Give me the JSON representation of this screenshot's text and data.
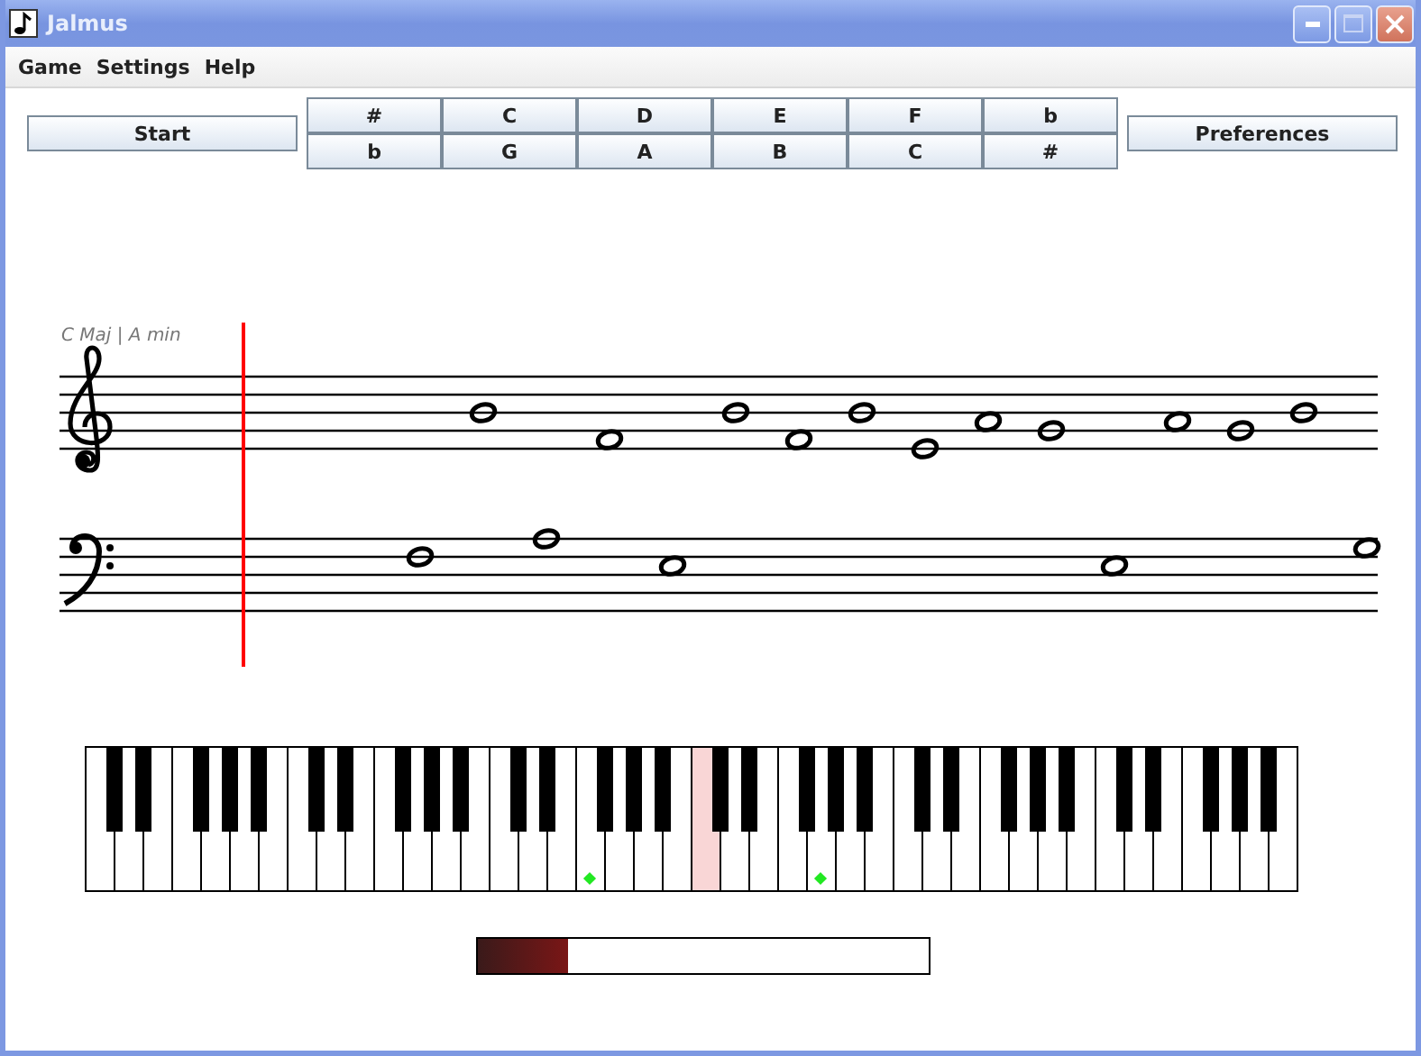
{
  "window": {
    "title": "Jalmus"
  },
  "menu": [
    "Game",
    "Settings",
    "Help"
  ],
  "start_button": "Start",
  "note_buttons": [
    [
      "#",
      "C",
      "D",
      "E",
      "F",
      "b"
    ],
    [
      "b",
      "G",
      "A",
      "B",
      "C",
      "#"
    ]
  ],
  "preferences_button": "Preferences",
  "key_signature": "C Maj | A min",
  "keyboard": {
    "white_keys": [
      {
        "selected": false,
        "marked": false
      },
      {
        "selected": false,
        "marked": false
      },
      {
        "selected": false,
        "marked": false
      },
      {
        "selected": false,
        "marked": false
      },
      {
        "selected": false,
        "marked": false
      },
      {
        "selected": false,
        "marked": false
      },
      {
        "selected": false,
        "marked": false
      },
      {
        "selected": false,
        "marked": false
      },
      {
        "selected": false,
        "marked": false
      },
      {
        "selected": false,
        "marked": false
      },
      {
        "selected": false,
        "marked": false
      },
      {
        "selected": false,
        "marked": false
      },
      {
        "selected": false,
        "marked": false
      },
      {
        "selected": false,
        "marked": false
      },
      {
        "selected": false,
        "marked": false
      },
      {
        "selected": false,
        "marked": false
      },
      {
        "selected": false,
        "marked": false
      },
      {
        "selected": false,
        "marked": true
      },
      {
        "selected": false,
        "marked": false
      },
      {
        "selected": false,
        "marked": false
      },
      {
        "selected": false,
        "marked": false
      },
      {
        "selected": true,
        "marked": false
      },
      {
        "selected": false,
        "marked": false
      },
      {
        "selected": false,
        "marked": false
      },
      {
        "selected": false,
        "marked": false
      },
      {
        "selected": false,
        "marked": true
      },
      {
        "selected": false,
        "marked": false
      },
      {
        "selected": false,
        "marked": false
      },
      {
        "selected": false,
        "marked": false
      },
      {
        "selected": false,
        "marked": false
      },
      {
        "selected": false,
        "marked": false
      },
      {
        "selected": false,
        "marked": false
      },
      {
        "selected": false,
        "marked": false
      },
      {
        "selected": false,
        "marked": false
      },
      {
        "selected": false,
        "marked": false
      },
      {
        "selected": false,
        "marked": false
      },
      {
        "selected": false,
        "marked": false
      },
      {
        "selected": false,
        "marked": false
      },
      {
        "selected": false,
        "marked": false
      },
      {
        "selected": false,
        "marked": false
      },
      {
        "selected": false,
        "marked": false
      },
      {
        "selected": false,
        "marked": false
      }
    ]
  },
  "progress": {
    "level": 0.2
  }
}
